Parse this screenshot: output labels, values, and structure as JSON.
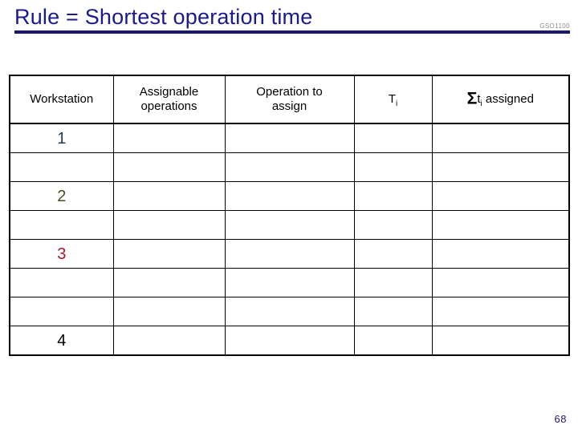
{
  "slide": {
    "title": "Rule = Shortest operation time",
    "course_code": "GSO1100",
    "page_number": "68",
    "accent_color": "#191970",
    "title_color": "#1a1a8c",
    "course_code_color": "#8a8a8a"
  },
  "table": {
    "name": "workstation-assignment-worksheet",
    "columns": [
      {
        "id": "workstation",
        "label": "Workstation",
        "line2": ""
      },
      {
        "id": "assignable-operations",
        "label": "Assignable",
        "line2": "operations"
      },
      {
        "id": "operation-to-assign",
        "label": "Operation to",
        "line2": "assign"
      },
      {
        "id": "ti",
        "label": "T",
        "sub": "i",
        "line2": ""
      },
      {
        "id": "sum-ti-assigned",
        "sigma": "Σ",
        "label": "t",
        "sub": "i",
        "suffix": " assigned",
        "line2": ""
      }
    ],
    "rows": [
      {
        "workstation": "1",
        "workstation_color": "#1f3a5c",
        "assignable_operations": "",
        "operation_to_assign": "",
        "ti": "",
        "sum_ti_assigned": ""
      },
      {
        "workstation": "",
        "workstation_color": "#000000",
        "assignable_operations": "",
        "operation_to_assign": "",
        "ti": "",
        "sum_ti_assigned": ""
      },
      {
        "workstation": "2",
        "workstation_color": "#3e531b",
        "assignable_operations": "",
        "operation_to_assign": "",
        "ti": "",
        "sum_ti_assigned": ""
      },
      {
        "workstation": "",
        "workstation_color": "#000000",
        "assignable_operations": "",
        "operation_to_assign": "",
        "ti": "",
        "sum_ti_assigned": ""
      },
      {
        "workstation": "3",
        "workstation_color": "#b01427",
        "assignable_operations": "",
        "operation_to_assign": "",
        "ti": "",
        "sum_ti_assigned": ""
      },
      {
        "workstation": "",
        "workstation_color": "#000000",
        "assignable_operations": "",
        "operation_to_assign": "",
        "ti": "",
        "sum_ti_assigned": ""
      },
      {
        "workstation": "",
        "workstation_color": "#000000",
        "assignable_operations": "",
        "operation_to_assign": "",
        "ti": "",
        "sum_ti_assigned": ""
      },
      {
        "workstation": "4",
        "workstation_color": "#000000",
        "assignable_operations": "",
        "operation_to_assign": "",
        "ti": "",
        "sum_ti_assigned": ""
      }
    ]
  }
}
